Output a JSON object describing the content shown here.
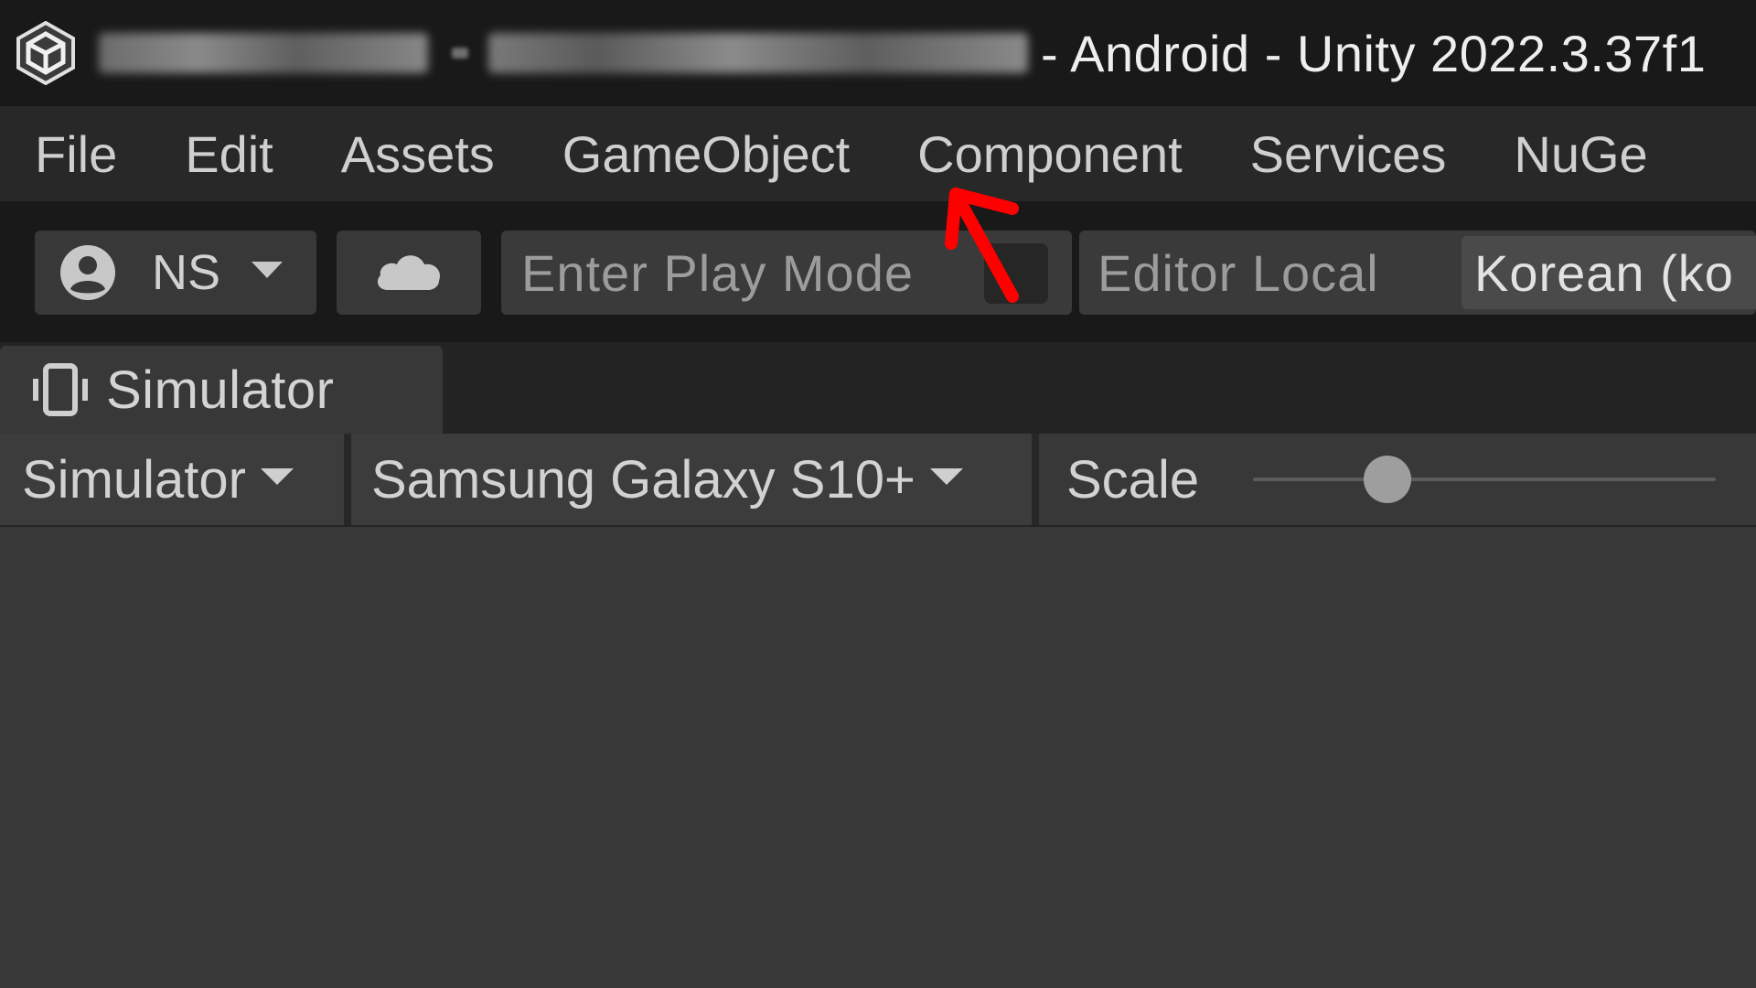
{
  "titlebar": {
    "title_suffix": "- Android - Unity 2022.3.37f1",
    "icon": "unity-logo-icon"
  },
  "menubar": {
    "items": [
      "File",
      "Edit",
      "Assets",
      "GameObject",
      "Component",
      "Services",
      "NuGe"
    ]
  },
  "toolbar": {
    "account_label": "NS",
    "account_icon": "user-icon",
    "cloud_icon": "cloud-icon",
    "playmode_label": "Enter Play Mode",
    "editor_locale_label": "Editor Local",
    "language_value": "Korean (ko"
  },
  "tab": {
    "label": "Simulator",
    "icon": "device-simulator-icon"
  },
  "simulator_toolbar": {
    "mode_label": "Simulator",
    "device_label": "Samsung Galaxy S10+",
    "scale_label": "Scale",
    "scale_value": 0.29
  },
  "colors": {
    "titlebar_bg": "#191919",
    "menubar_bg": "#282828",
    "panel_bg": "#383838",
    "annotation_arrow": "#ff0000"
  }
}
